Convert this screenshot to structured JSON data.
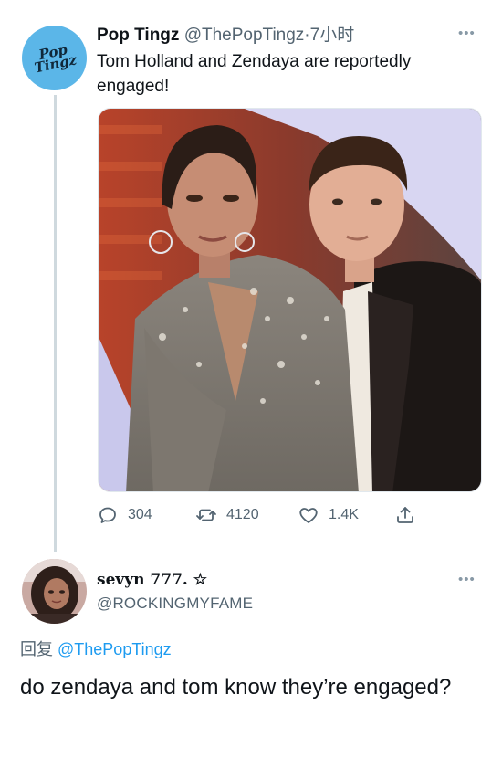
{
  "tweet": {
    "avatar_text": "Pop Tingz",
    "display_name": "Pop Tingz",
    "handle": "@ThePopTingz",
    "separator": "·",
    "time": "7小时",
    "more": "•••",
    "text": "Tom Holland and Zendaya are reportedly engaged!",
    "actions": {
      "reply_count": "304",
      "retweet_count": "4120",
      "like_count": "1.4K"
    }
  },
  "reply": {
    "display_name": "sevyn 777. ☆",
    "handle": "@ROCKINGMYFAME",
    "more": "•••",
    "reply_label": "回复",
    "reply_to": "@ThePopTingz",
    "text": "do zendaya and tom know they’re engaged?"
  },
  "colors": {
    "link": "#1d9bf0",
    "muted": "#536471",
    "text": "#0f1419",
    "thread_line": "#cfd9de",
    "avatar_bg": "#5bb6e8"
  },
  "icons": [
    "reply-icon",
    "retweet-icon",
    "like-icon",
    "share-icon",
    "more-icon"
  ]
}
